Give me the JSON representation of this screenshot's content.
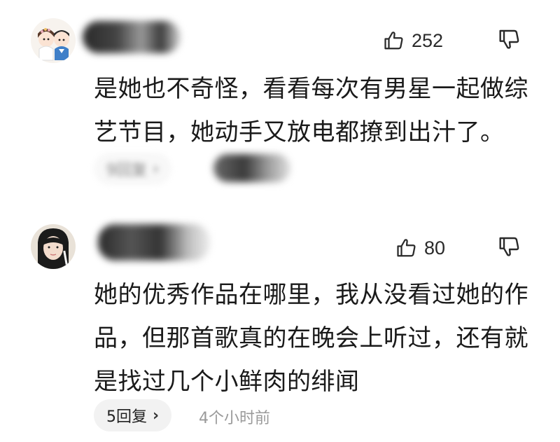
{
  "comments": [
    {
      "likes": "252",
      "lines": [
        "是她也不奇怪，看看每次有男星一起做综",
        "艺节目，她动手又放电都撩到出汁了。"
      ],
      "reply_label": "9回复",
      "reply_chevron": "›",
      "time": ""
    },
    {
      "likes": "80",
      "lines": [
        "她的优秀作品在哪里，我从没看过她的作",
        "品，但那首歌真的在晚会上听过，还有就",
        "是找过几个小鲜肉的绯闻"
      ],
      "reply_label": "5回复",
      "reply_chevron": "›",
      "time": "4个小时前"
    }
  ],
  "icons": {
    "like": "thumbs-up-icon",
    "dislike": "thumbs-down-icon"
  },
  "colors": {
    "text": "#1a1a1a",
    "secondary": "#9a9a9a",
    "pill_bg": "#f2f2f2"
  }
}
